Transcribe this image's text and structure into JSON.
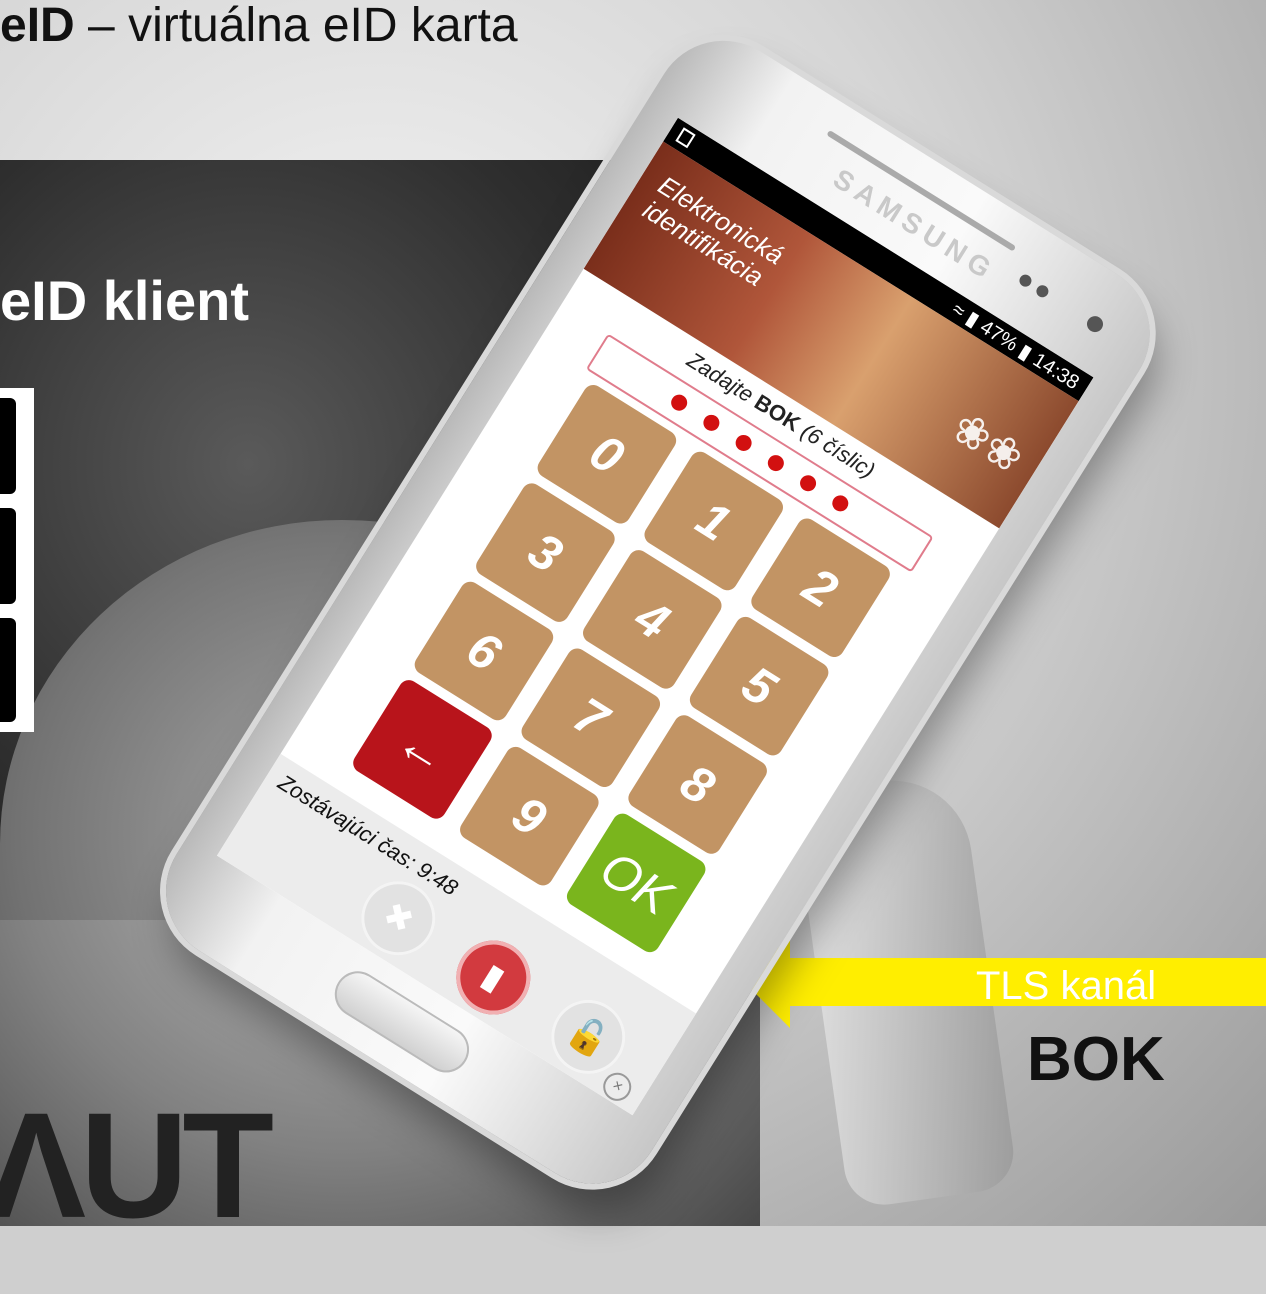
{
  "slide": {
    "title_bold": "eID",
    "title_rest": " – virtuálna eID karta",
    "subtitle": "eID klient",
    "logo_text": "ΛUT"
  },
  "annotation": {
    "tls_label": "TLS kanál",
    "bok_label": "BOK",
    "arrow_color": "#ffee00"
  },
  "phone": {
    "brand": "SAMSUNG",
    "statusbar": {
      "status": "47%",
      "time": "14:38"
    },
    "banner": {
      "title_line1": "Elektronická",
      "title_line2": "identifikácia"
    },
    "prompt": {
      "prefix": "Zadajte ",
      "bold": "BOK",
      "suffix": " (6 číslic)"
    },
    "pin_entered": 6,
    "keypad": {
      "keys": [
        "0",
        "1",
        "2",
        "3",
        "4",
        "5",
        "6",
        "7",
        "8",
        "9"
      ],
      "ok_label": "OK",
      "back_icon": "arrow-left-icon"
    },
    "timer_label": "Zostávajúci čas: 9:48",
    "bottom_icons": [
      "tools-icon",
      "trash-icon",
      "unlock-icon",
      "close-icon"
    ],
    "colors": {
      "key": "#c29464",
      "back": "#b8141b",
      "ok": "#7ab51d",
      "pin_dot": "#d21010"
    }
  }
}
